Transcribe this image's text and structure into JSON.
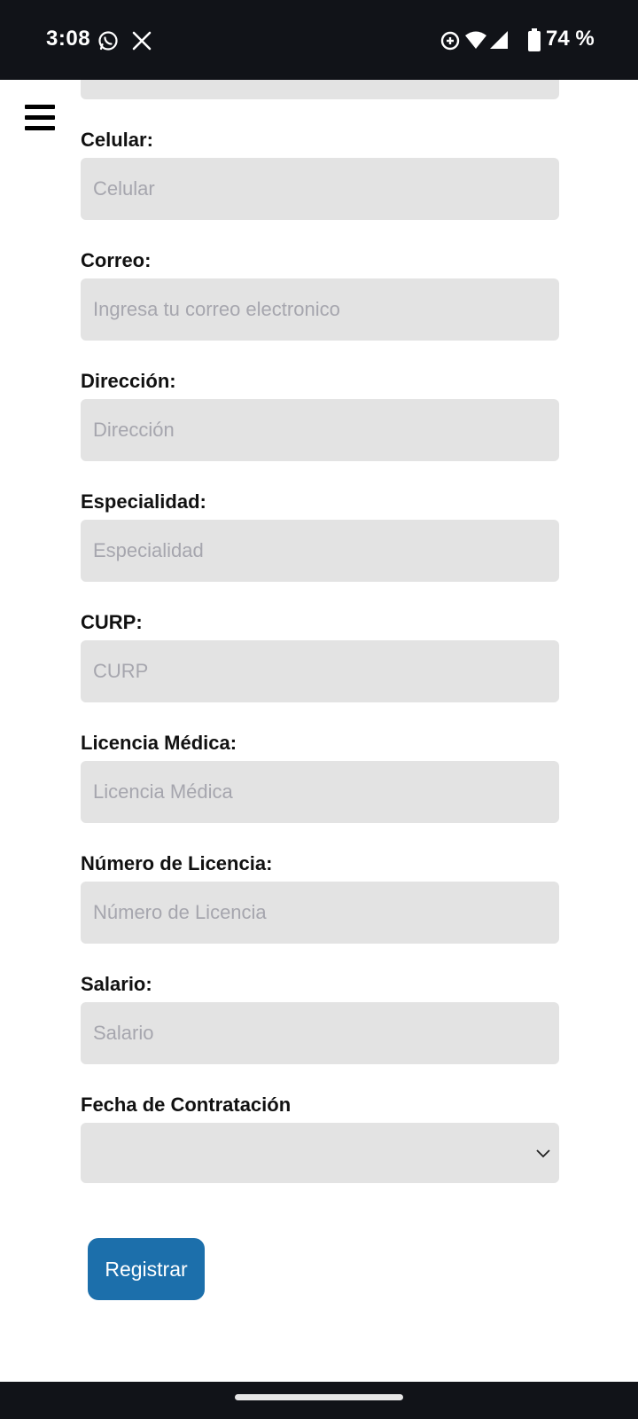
{
  "status_bar": {
    "time": "3:08",
    "battery": "74 %",
    "icons": [
      "whatsapp-icon",
      "x-icon",
      "data-saver-icon",
      "wifi-icon",
      "signal-icon",
      "battery-icon"
    ]
  },
  "menu": {
    "icon": "hamburger-menu-icon"
  },
  "form": {
    "fields": [
      {
        "label": "Celular:",
        "placeholder": "Celular"
      },
      {
        "label": "Correo:",
        "placeholder": "Ingresa tu correo electronico"
      },
      {
        "label": "Dirección:",
        "placeholder": "Dirección"
      },
      {
        "label": "Especialidad:",
        "placeholder": "Especialidad"
      },
      {
        "label": "CURP:",
        "placeholder": "CURP"
      },
      {
        "label": "Licencia Médica:",
        "placeholder": "Licencia Médica"
      },
      {
        "label": "Número de Licencia:",
        "placeholder": "Número de Licencia"
      },
      {
        "label": "Salario:",
        "placeholder": "Salario"
      }
    ],
    "date_field": {
      "label": "Fecha de Contratación",
      "value": ""
    },
    "submit_label": "Registrar"
  },
  "colors": {
    "status_bar_bg": "#111318",
    "field_bg": "#e3e3e3",
    "placeholder": "#a6a6ae",
    "button_bg": "#1c6fab"
  }
}
